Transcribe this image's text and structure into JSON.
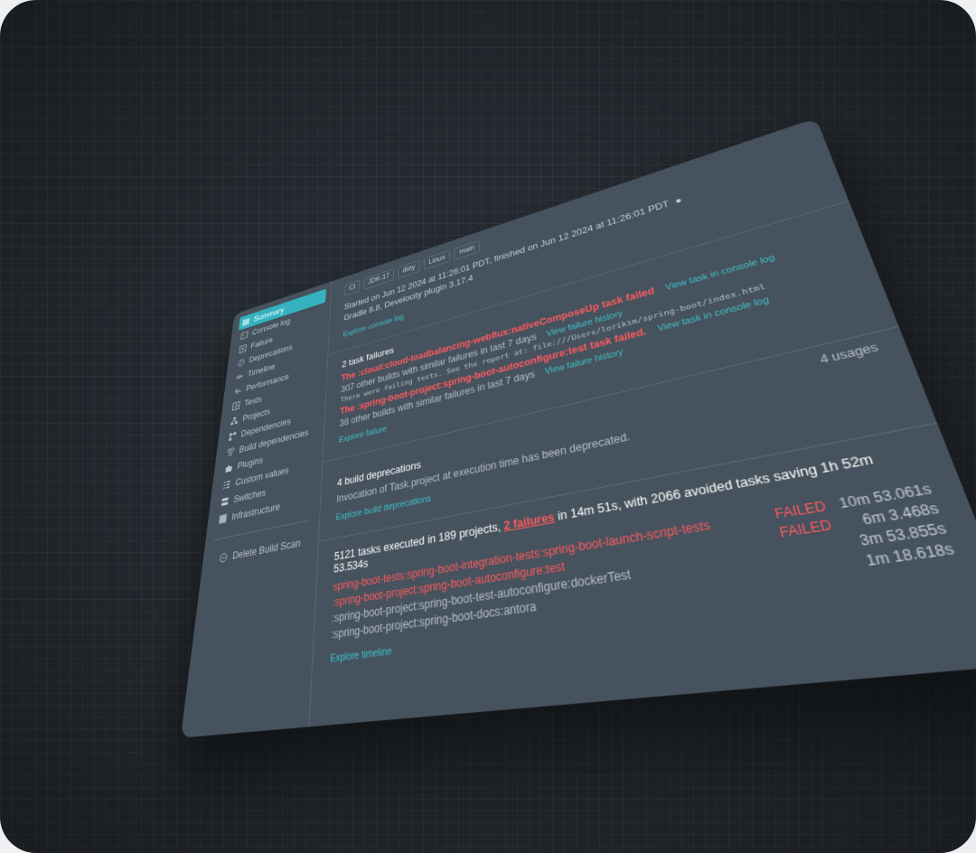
{
  "sidebar": {
    "items": [
      {
        "label": "Summary",
        "icon": "summary-icon"
      },
      {
        "label": "Console log",
        "icon": "console-icon"
      },
      {
        "label": "Failure",
        "icon": "failure-icon"
      },
      {
        "label": "Deprecations",
        "icon": "deprecations-icon"
      },
      {
        "label": "Timeline",
        "icon": "timeline-icon"
      },
      {
        "label": "Performance",
        "icon": "performance-icon"
      },
      {
        "label": "Tests",
        "icon": "tests-icon"
      },
      {
        "label": "Projects",
        "icon": "projects-icon"
      },
      {
        "label": "Dependencies",
        "icon": "dependencies-icon"
      },
      {
        "label": "Build dependencies",
        "icon": "build-dependencies-icon"
      },
      {
        "label": "Plugins",
        "icon": "plugins-icon"
      },
      {
        "label": "Custom values",
        "icon": "custom-values-icon"
      },
      {
        "label": "Switches",
        "icon": "switches-icon"
      },
      {
        "label": "Infrastructure",
        "icon": "infrastructure-icon"
      }
    ],
    "delete_label": "Delete Build Scan"
  },
  "header": {
    "tags": [
      "CI",
      "JDK-17",
      "dirty",
      "Linux",
      "main"
    ],
    "started": "Started on Jun 12 2024 at 11:26:01 PDT, finished on Jun 12 2024 at 11:26:01 PDT",
    "gradle": "Gradle 8.8, Develocity plugin 3.17.4",
    "explore_console": "Explore console log"
  },
  "failures": {
    "title": "2 task failures",
    "items": [
      {
        "task": "The :cloud:cloud-loadbalancing-webflux:nativeComposeUp task failed",
        "view": "View task in console log",
        "similar": "307 other builds with similar failures in last 7 days",
        "history": "View failure history",
        "detail": "There were failing tests. See the report at: file:///Users/lorikim/spring-boot/index.html"
      },
      {
        "task": "The :spring-boot-project:spring-boot-autoconfigure:test task failed.",
        "view": "View task in console log",
        "similar": "38 other builds with similar failures in last 7 days",
        "history": "View failure history"
      }
    ],
    "explore": "Explore failure"
  },
  "deprecations": {
    "title": "4 build deprecations",
    "usages": "4 usages",
    "text": "Invocation of Task.project at execution time has been deprecated.",
    "explore": "Explore build deprecations"
  },
  "tasks": {
    "summary_pre": "5121 tasks executed in 189 projects, ",
    "summary_link": "2 failures",
    "summary_post": " in 14m 51s, with 2066 avoided tasks saving 1h 52m 53.534s",
    "rows": [
      {
        "name": "spring-boot-tests:spring-boot-integration-tests:spring-boot-launch-script-tests",
        "status": "FAILED",
        "time": "10m 53.061s",
        "failed": true
      },
      {
        "name": ":spring-boot-project:spring-boot-autoconfigure:test",
        "status": "FAILED",
        "time": "6m 3.468s",
        "failed": true
      },
      {
        "name": ":spring-boot-project:spring-boot-test-autoconfigure:dockerTest",
        "status": "",
        "time": "3m 53.855s",
        "failed": false
      },
      {
        "name": ":spring-boot-project:spring-boot-docs:antora",
        "status": "",
        "time": "1m 18.618s",
        "failed": false
      }
    ],
    "explore": "Explore timeline"
  },
  "colors": {
    "accent": "#34b2bf",
    "link": "#3fc2cc",
    "failure": "#ff5a5f",
    "panel": "#46525d",
    "background": "#252b31"
  }
}
